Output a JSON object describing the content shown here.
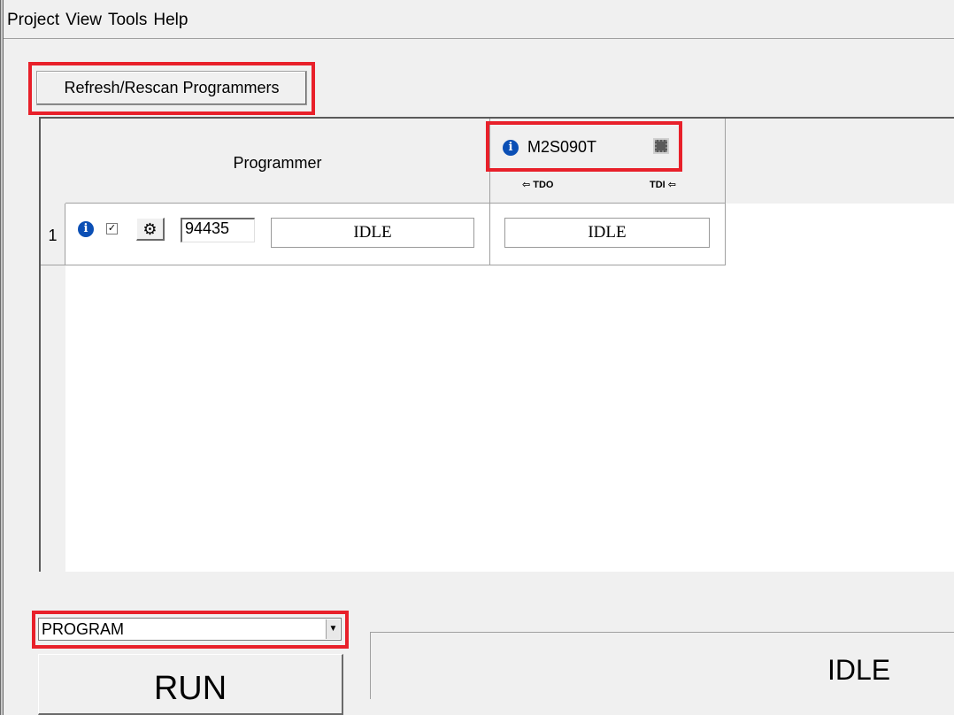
{
  "menu": [
    "Project",
    "View",
    "Tools",
    "Help"
  ],
  "toolbar": {
    "refresh_label": "Refresh/Rescan Programmers"
  },
  "grid": {
    "programmer_header": "Programmer",
    "device": {
      "name": "M2S090T",
      "tdo_label": "⇦ TDO",
      "tdi_label": "TDI ⇦"
    },
    "rows": [
      {
        "num": "1",
        "serial": "94435",
        "programmer_status": "IDLE",
        "device_status": "IDLE",
        "enabled": true
      }
    ]
  },
  "action": {
    "selected": "PROGRAM"
  },
  "run_label": "RUN",
  "status_text": "IDLE",
  "colors": {
    "highlight": "#e8202a",
    "info": "#0b4fb5"
  }
}
